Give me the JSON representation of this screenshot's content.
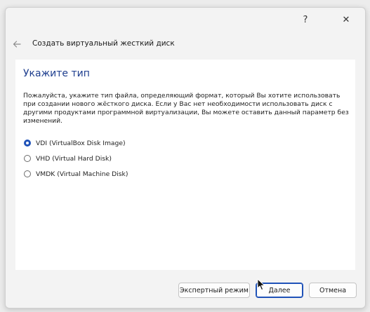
{
  "window": {
    "help_glyph": "?",
    "close_glyph": "✕"
  },
  "header": {
    "title": "Создать виртуальный жесткий диск"
  },
  "page": {
    "heading": "Укажите тип",
    "description": "Пожалуйста, укажите тип файла, определяющий формат, который Вы хотите использовать при создании нового жёсткого диска. Если у Вас нет необходимости использовать диск с другими продуктами программной виртуализации, Вы можете оставить данный параметр без изменений."
  },
  "options": [
    {
      "label": "VDI (VirtualBox Disk Image)",
      "checked": true
    },
    {
      "label": "VHD (Virtual Hard Disk)",
      "checked": false
    },
    {
      "label": "VMDK (Virtual Machine Disk)",
      "checked": false
    }
  ],
  "buttons": {
    "expert": "Экспертный режим",
    "next": "Далее",
    "cancel": "Отмена"
  },
  "colors": {
    "accent": "#1f52b8",
    "heading": "#1f3f8f"
  }
}
